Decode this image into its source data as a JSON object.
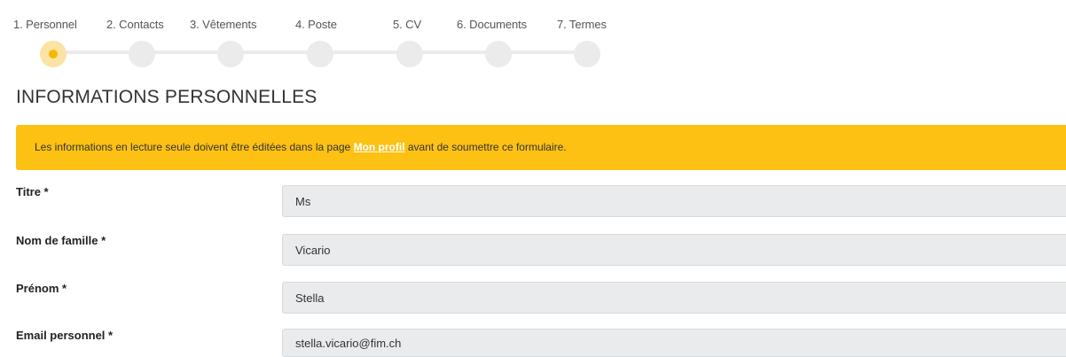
{
  "steps": [
    {
      "label": "1. Personnel",
      "active": true
    },
    {
      "label": "2. Contacts",
      "active": false
    },
    {
      "label": "3. Vêtements",
      "active": false
    },
    {
      "label": "4. Poste",
      "active": false
    },
    {
      "label": "5. CV",
      "active": false
    },
    {
      "label": "6. Documents",
      "active": false
    },
    {
      "label": "7. Termes",
      "active": false
    }
  ],
  "page_title": "INFORMATIONS PERSONNELLES",
  "alert": {
    "text_before": "Les informations en lecture seule doivent être éditées dans la page ",
    "link_text": "Mon profil",
    "text_after": " avant de soumettre ce formulaire.",
    "color": "#fdc114"
  },
  "fields": [
    {
      "label": "Titre *",
      "value": "Ms"
    },
    {
      "label": "Nom de famille *",
      "value": "Vicario"
    },
    {
      "label": "Prénom *",
      "value": "Stella"
    },
    {
      "label": "Email personnel *",
      "value": "stella.vicario@fim.ch"
    }
  ],
  "colors": {
    "accent": "#f5b800",
    "accent_light": "#fbe3a6",
    "step_inactive": "#ebebeb",
    "input_bg": "#e9ebed"
  }
}
